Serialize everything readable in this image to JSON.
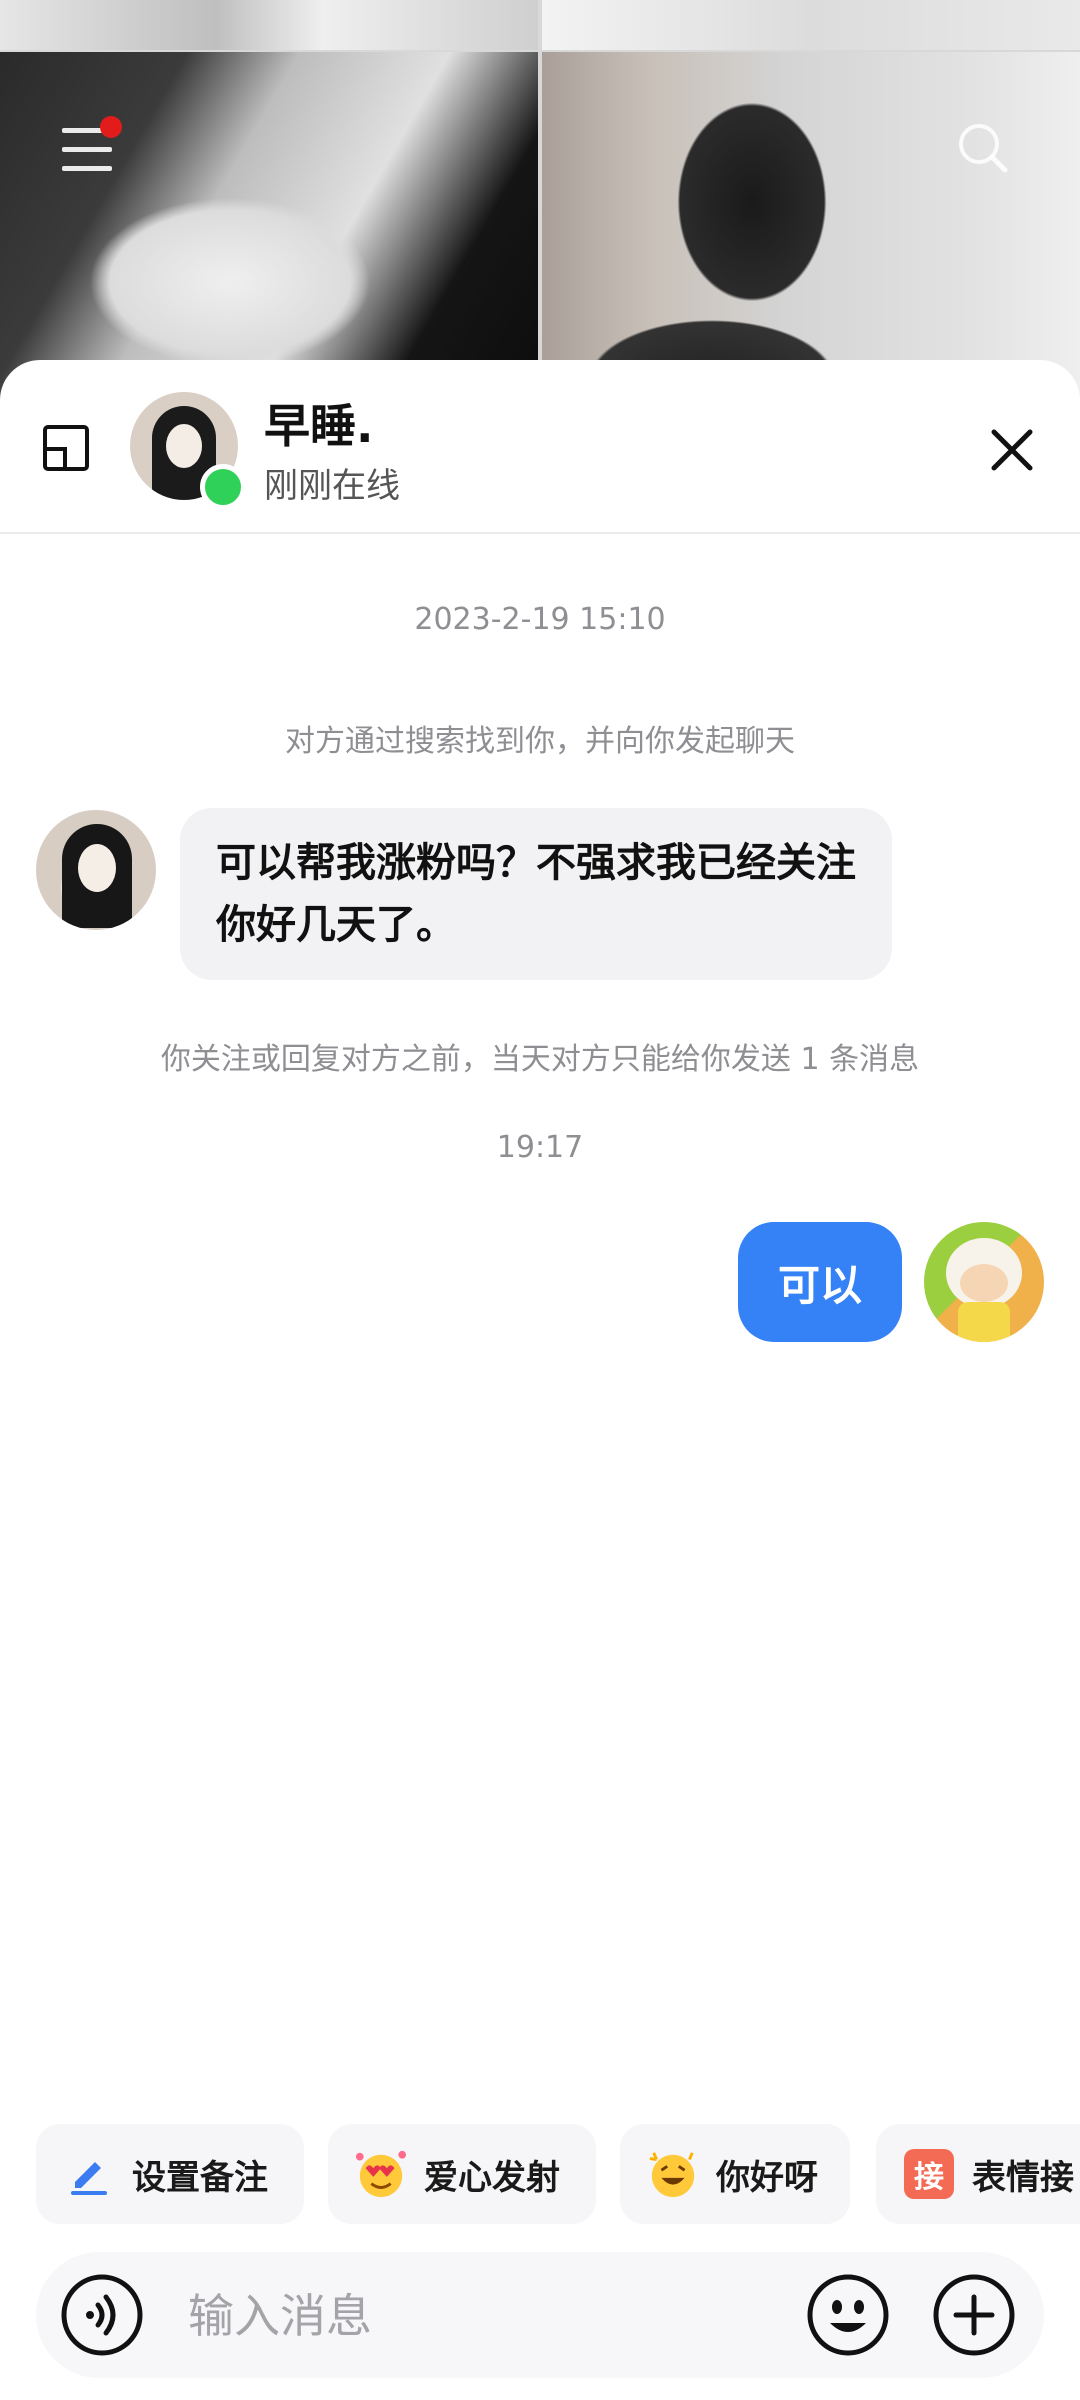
{
  "header": {
    "contact_name": "早睡.",
    "status": "刚刚在线"
  },
  "messages": {
    "date_time": "2023-2-19 15:10",
    "system_notice_1": "对方通过搜索找到你，并向你发起聊天",
    "incoming_text": "可以帮我涨粉吗？不强求我已经关注你好几天了。",
    "system_notice_2": "你关注或回复对方之前，当天对方只能给你发送 1 条消息",
    "time_2": "19:17",
    "outgoing_text": "可以"
  },
  "quick_actions": [
    {
      "label": "设置备注",
      "icon": "edit-pen-icon"
    },
    {
      "label": "爱心发射",
      "icon": "heart-eyes-emoji-icon"
    },
    {
      "label": "你好呀",
      "icon": "grinning-emoji-icon"
    },
    {
      "label": "表情接",
      "icon": "jie-badge-icon",
      "badge": "接"
    }
  ],
  "input": {
    "placeholder": "输入消息"
  },
  "colors": {
    "accent_blue": "#3482f6",
    "online_green": "#2fd158",
    "notification_red": "#e21b1b"
  }
}
